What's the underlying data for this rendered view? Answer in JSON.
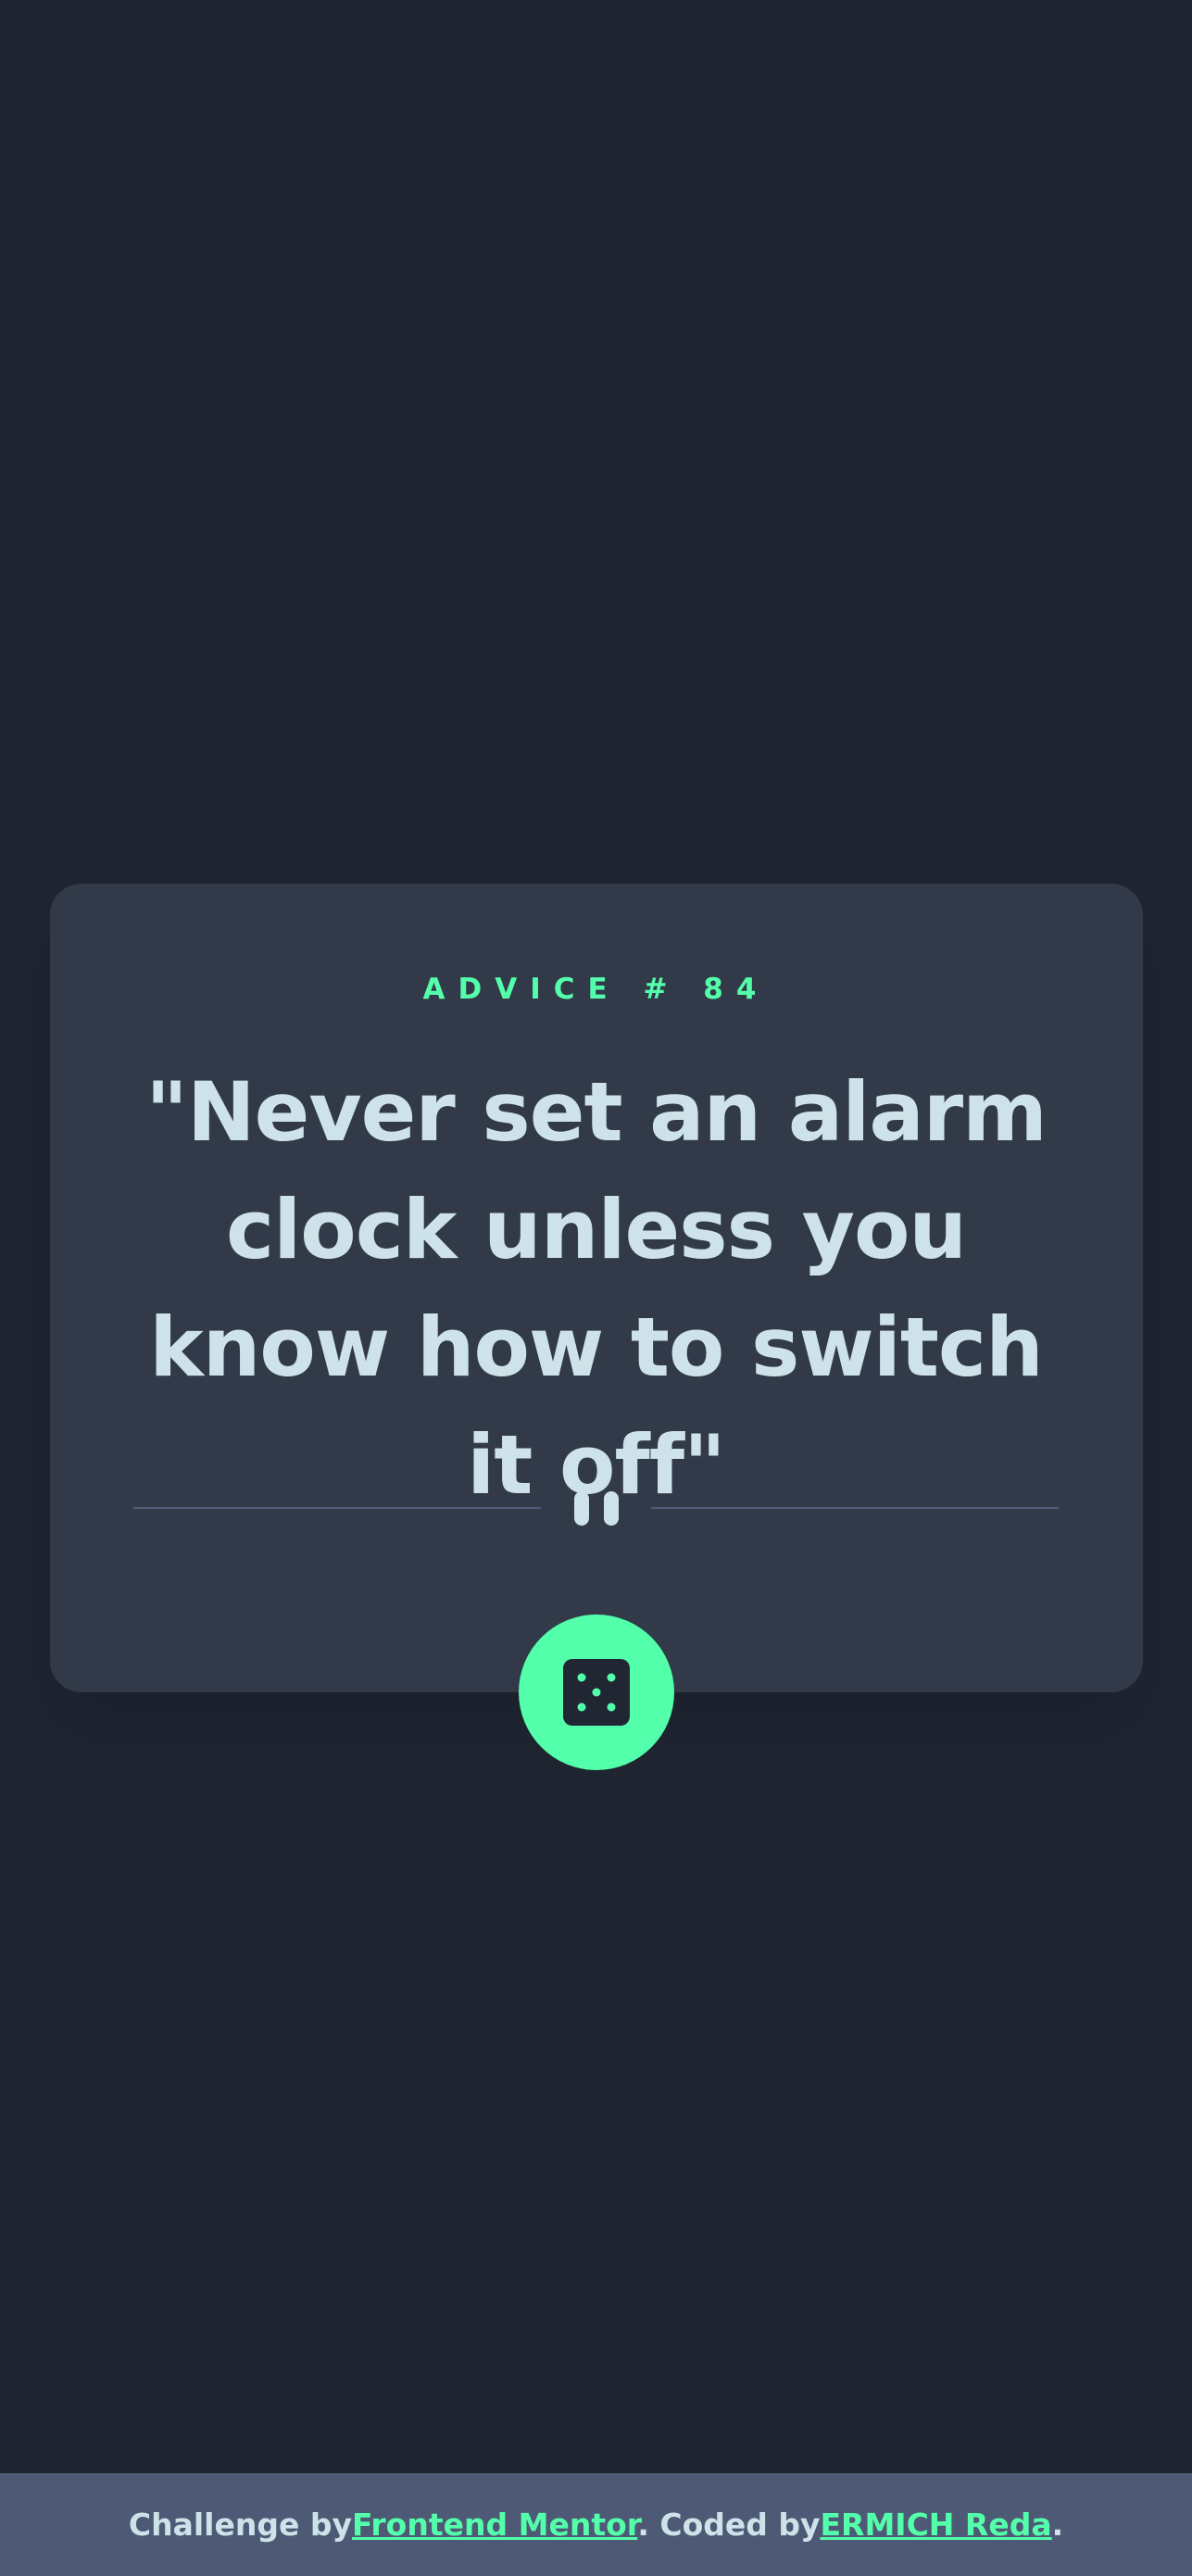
{
  "advice": {
    "label": "ADVICE # 84",
    "quote": "\"Never set an alarm clock unless you know how to switch it off\""
  },
  "footer": {
    "prefix": "Challenge by",
    "link1": "Frontend Mentor",
    "middle": ". Coded by",
    "link2": "ERMICH Reda",
    "suffix": "."
  },
  "colors": {
    "background": "#1f2632",
    "card": "#323a49",
    "accent": "#53ffaa",
    "text": "#cee3e9",
    "footer": "#4e5a75"
  },
  "icons": {
    "divider": "pause-icon",
    "button": "dice-icon"
  }
}
